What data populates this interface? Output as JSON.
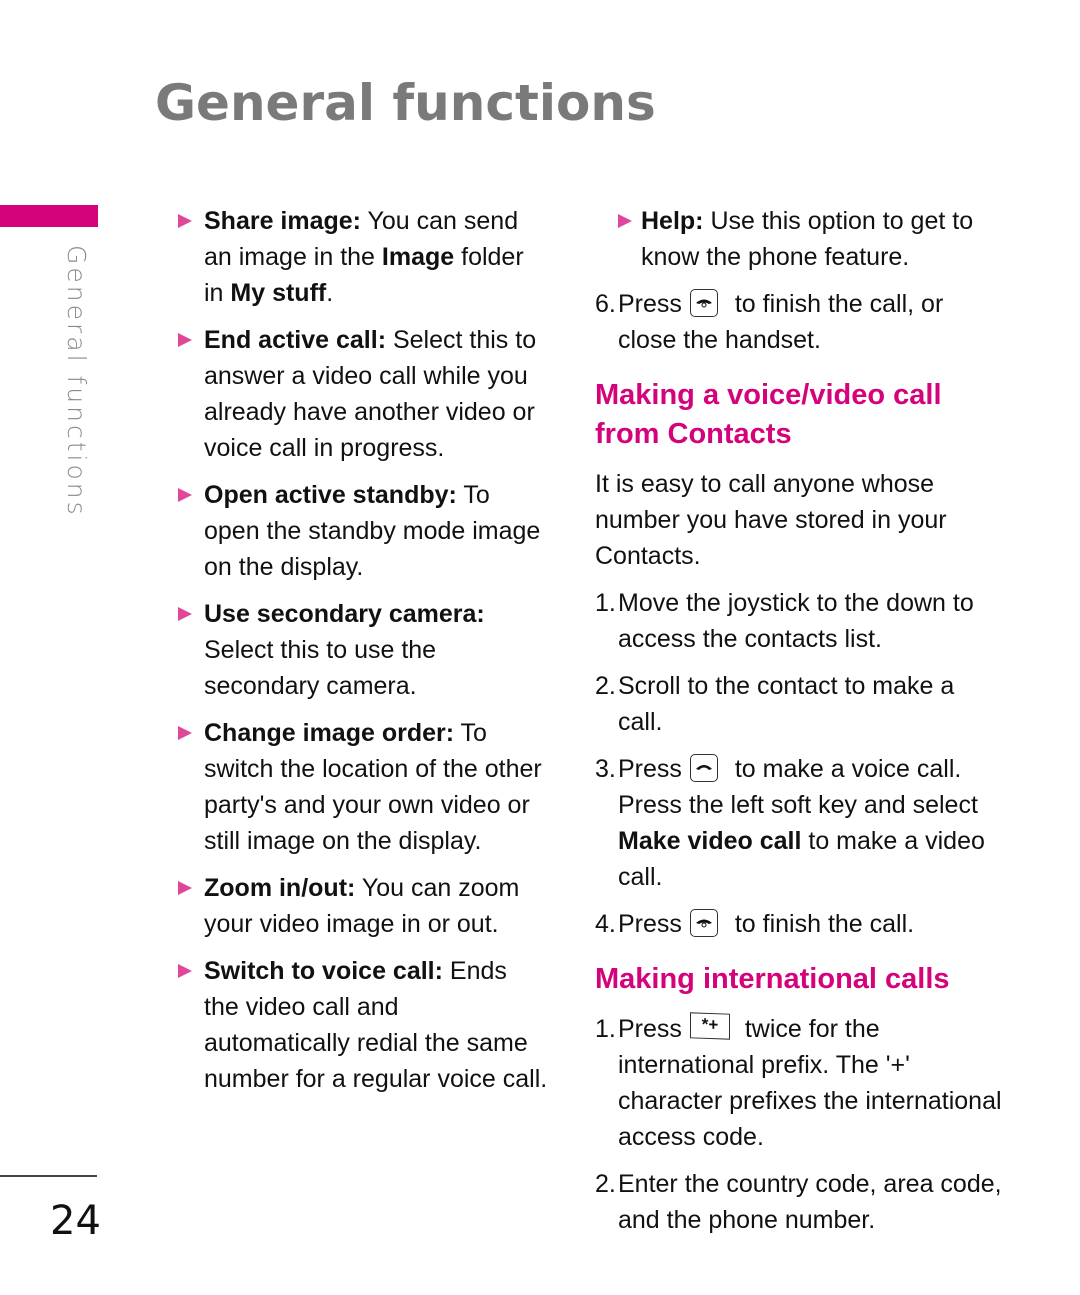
{
  "header": {
    "title": "General functions"
  },
  "sidebar": {
    "section_label": "General functions",
    "accent_color": "#d4037b"
  },
  "footer": {
    "page_number": "24"
  },
  "left_column": {
    "bullets": [
      {
        "term": "Share image:",
        "text_1": " You can send an image in the ",
        "term_2": "Image",
        "text_2": " folder in ",
        "term_3": "My stuff",
        "text_3": "."
      },
      {
        "term": "End active call:",
        "text": " Select this to answer a video call while you already have another video or voice call in progress."
      },
      {
        "term": "Open active standby:",
        "text": " To open the standby mode image on the display."
      },
      {
        "term": "Use secondary camera:",
        "text": " Select this to use the secondary camera."
      },
      {
        "term": "Change image order:",
        "text": " To switch the location of the other party's and your own video or still image on the display."
      },
      {
        "term": "Zoom in/out:",
        "text": " You can zoom your video image in or out."
      },
      {
        "term": "Switch to voice call:",
        "text": " Ends the video call and automatically redial the same number for a regular voice call."
      }
    ]
  },
  "right_column": {
    "help_bullet": {
      "term": "Help:",
      "text": " Use this option to get to know the phone feature."
    },
    "step6": {
      "num": "6.",
      "before": "Press",
      "icon": "end-call-key-icon",
      "after": " to finish the call, or close the handset."
    },
    "section_contacts": {
      "heading": "Making a voice/video call from Contacts",
      "intro": "It is easy to call anyone whose number you have stored in your Contacts.",
      "steps": [
        {
          "num": "1.",
          "text": "Move the joystick to the down to access the contacts list."
        },
        {
          "num": "2.",
          "text": "Scroll to the contact to make a call."
        },
        {
          "num": "3.",
          "before": "Press",
          "icon": "send-call-key-icon",
          "after_1": " to make a voice call. Press the left soft key and select ",
          "term": "Make video call",
          "after_2": " to make a video call."
        },
        {
          "num": "4.",
          "before": "Press",
          "icon": "end-call-key-icon",
          "after": " to finish the call."
        }
      ]
    },
    "section_international": {
      "heading": "Making international calls",
      "steps": [
        {
          "num": "1.",
          "before": "Press",
          "key_label": "*+",
          "after": " twice for the international prefix. The '+' character prefixes the international access code."
        },
        {
          "num": "2.",
          "text": "Enter the country code, area code, and the phone number."
        }
      ]
    }
  }
}
